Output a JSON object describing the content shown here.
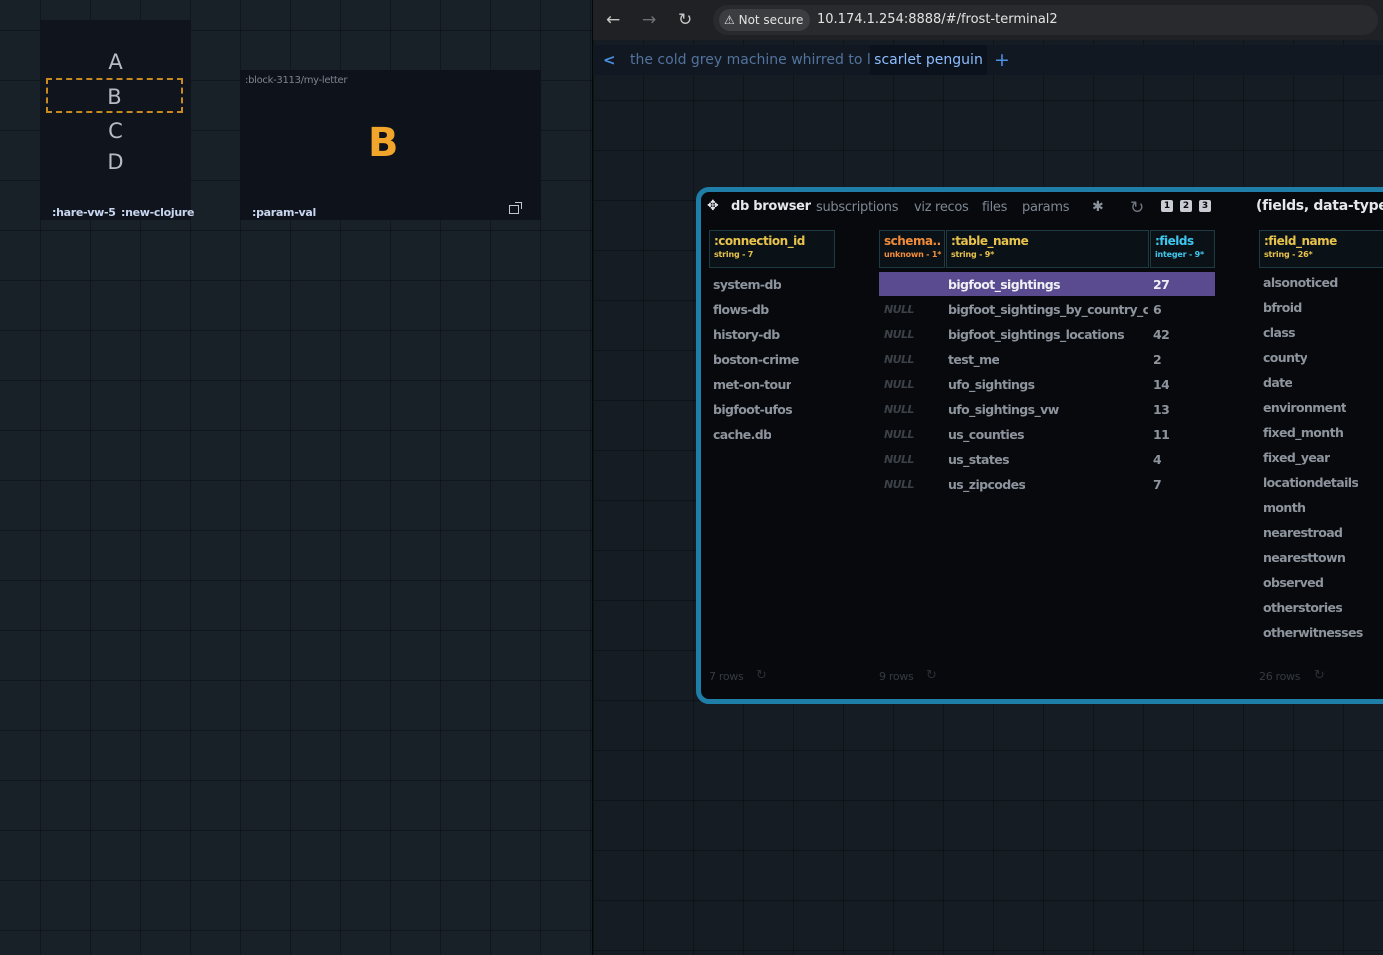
{
  "left": {
    "letters": [
      "A",
      "B",
      "C",
      "D"
    ],
    "selected_letter": "B",
    "block_label": ":block-3113/my-letter",
    "block_value": "B",
    "footer": [
      ":hare-vw-5",
      ":new-clojure",
      ":param-val"
    ],
    "colors": {
      "selected_border": "#c98a20",
      "value": "#f1a52a"
    }
  },
  "browser": {
    "security_label": "Not secure",
    "url": "10.174.1.254:8888/#/frost-terminal2",
    "tabs": [
      "the cold grey machine whirred to life",
      "scarlet penguin"
    ],
    "active_tab": "scarlet penguin",
    "add_tab": "+",
    "back_tab": "<"
  },
  "db_browser": {
    "title": "db browser",
    "tabs": [
      "subscriptions",
      "viz recos",
      "files",
      "params"
    ],
    "badges": [
      "1",
      "2",
      "3"
    ],
    "section_title": "(fields, data-types)",
    "columns": [
      {
        "name": ":connection_id",
        "type": "string - 7",
        "color": "#e8c34c"
      },
      {
        "name": "schema..",
        "type": "unknown - 1*",
        "color": "#f28c3a"
      },
      {
        "name": ":table_name",
        "type": "string - 9*",
        "color": "#e8c34c"
      },
      {
        "name": ":fields",
        "type": "integer - 9*",
        "color": "#3fc8ef"
      },
      {
        "name": ":field_name",
        "type": "string - 26*",
        "color": "#e8c34c"
      }
    ],
    "connections": [
      "system-db",
      "flows-db",
      "history-db",
      "boston-crime",
      "met-on-tour",
      "bigfoot-ufos",
      "cache.db"
    ],
    "tables": [
      {
        "schema": "",
        "name": "bigfoot_sightings",
        "fields": "27"
      },
      {
        "schema": "NULL",
        "name": "bigfoot_sightings_by_country_cod",
        "fields": "6"
      },
      {
        "schema": "NULL",
        "name": "bigfoot_sightings_locations",
        "fields": "42"
      },
      {
        "schema": "NULL",
        "name": "test_me",
        "fields": "2"
      },
      {
        "schema": "NULL",
        "name": "ufo_sightings",
        "fields": "14"
      },
      {
        "schema": "NULL",
        "name": "ufo_sightings_vw",
        "fields": "13"
      },
      {
        "schema": "NULL",
        "name": "us_counties",
        "fields": "11"
      },
      {
        "schema": "NULL",
        "name": "us_states",
        "fields": "4"
      },
      {
        "schema": "NULL",
        "name": "us_zipcodes",
        "fields": "7"
      }
    ],
    "field_names": [
      "alsonoticed",
      "bfroid",
      "class",
      "county",
      "date",
      "environment",
      "fixed_month",
      "fixed_year",
      "locationdetails",
      "month",
      "nearestroad",
      "nearesttown",
      "observed",
      "otherstories",
      "otherwitnesses"
    ],
    "row_counts": [
      "7 rows",
      "9 rows",
      "26 rows"
    ],
    "colors": {
      "border": "#1f7ea8",
      "selected_row": "#5a4a8f"
    }
  }
}
